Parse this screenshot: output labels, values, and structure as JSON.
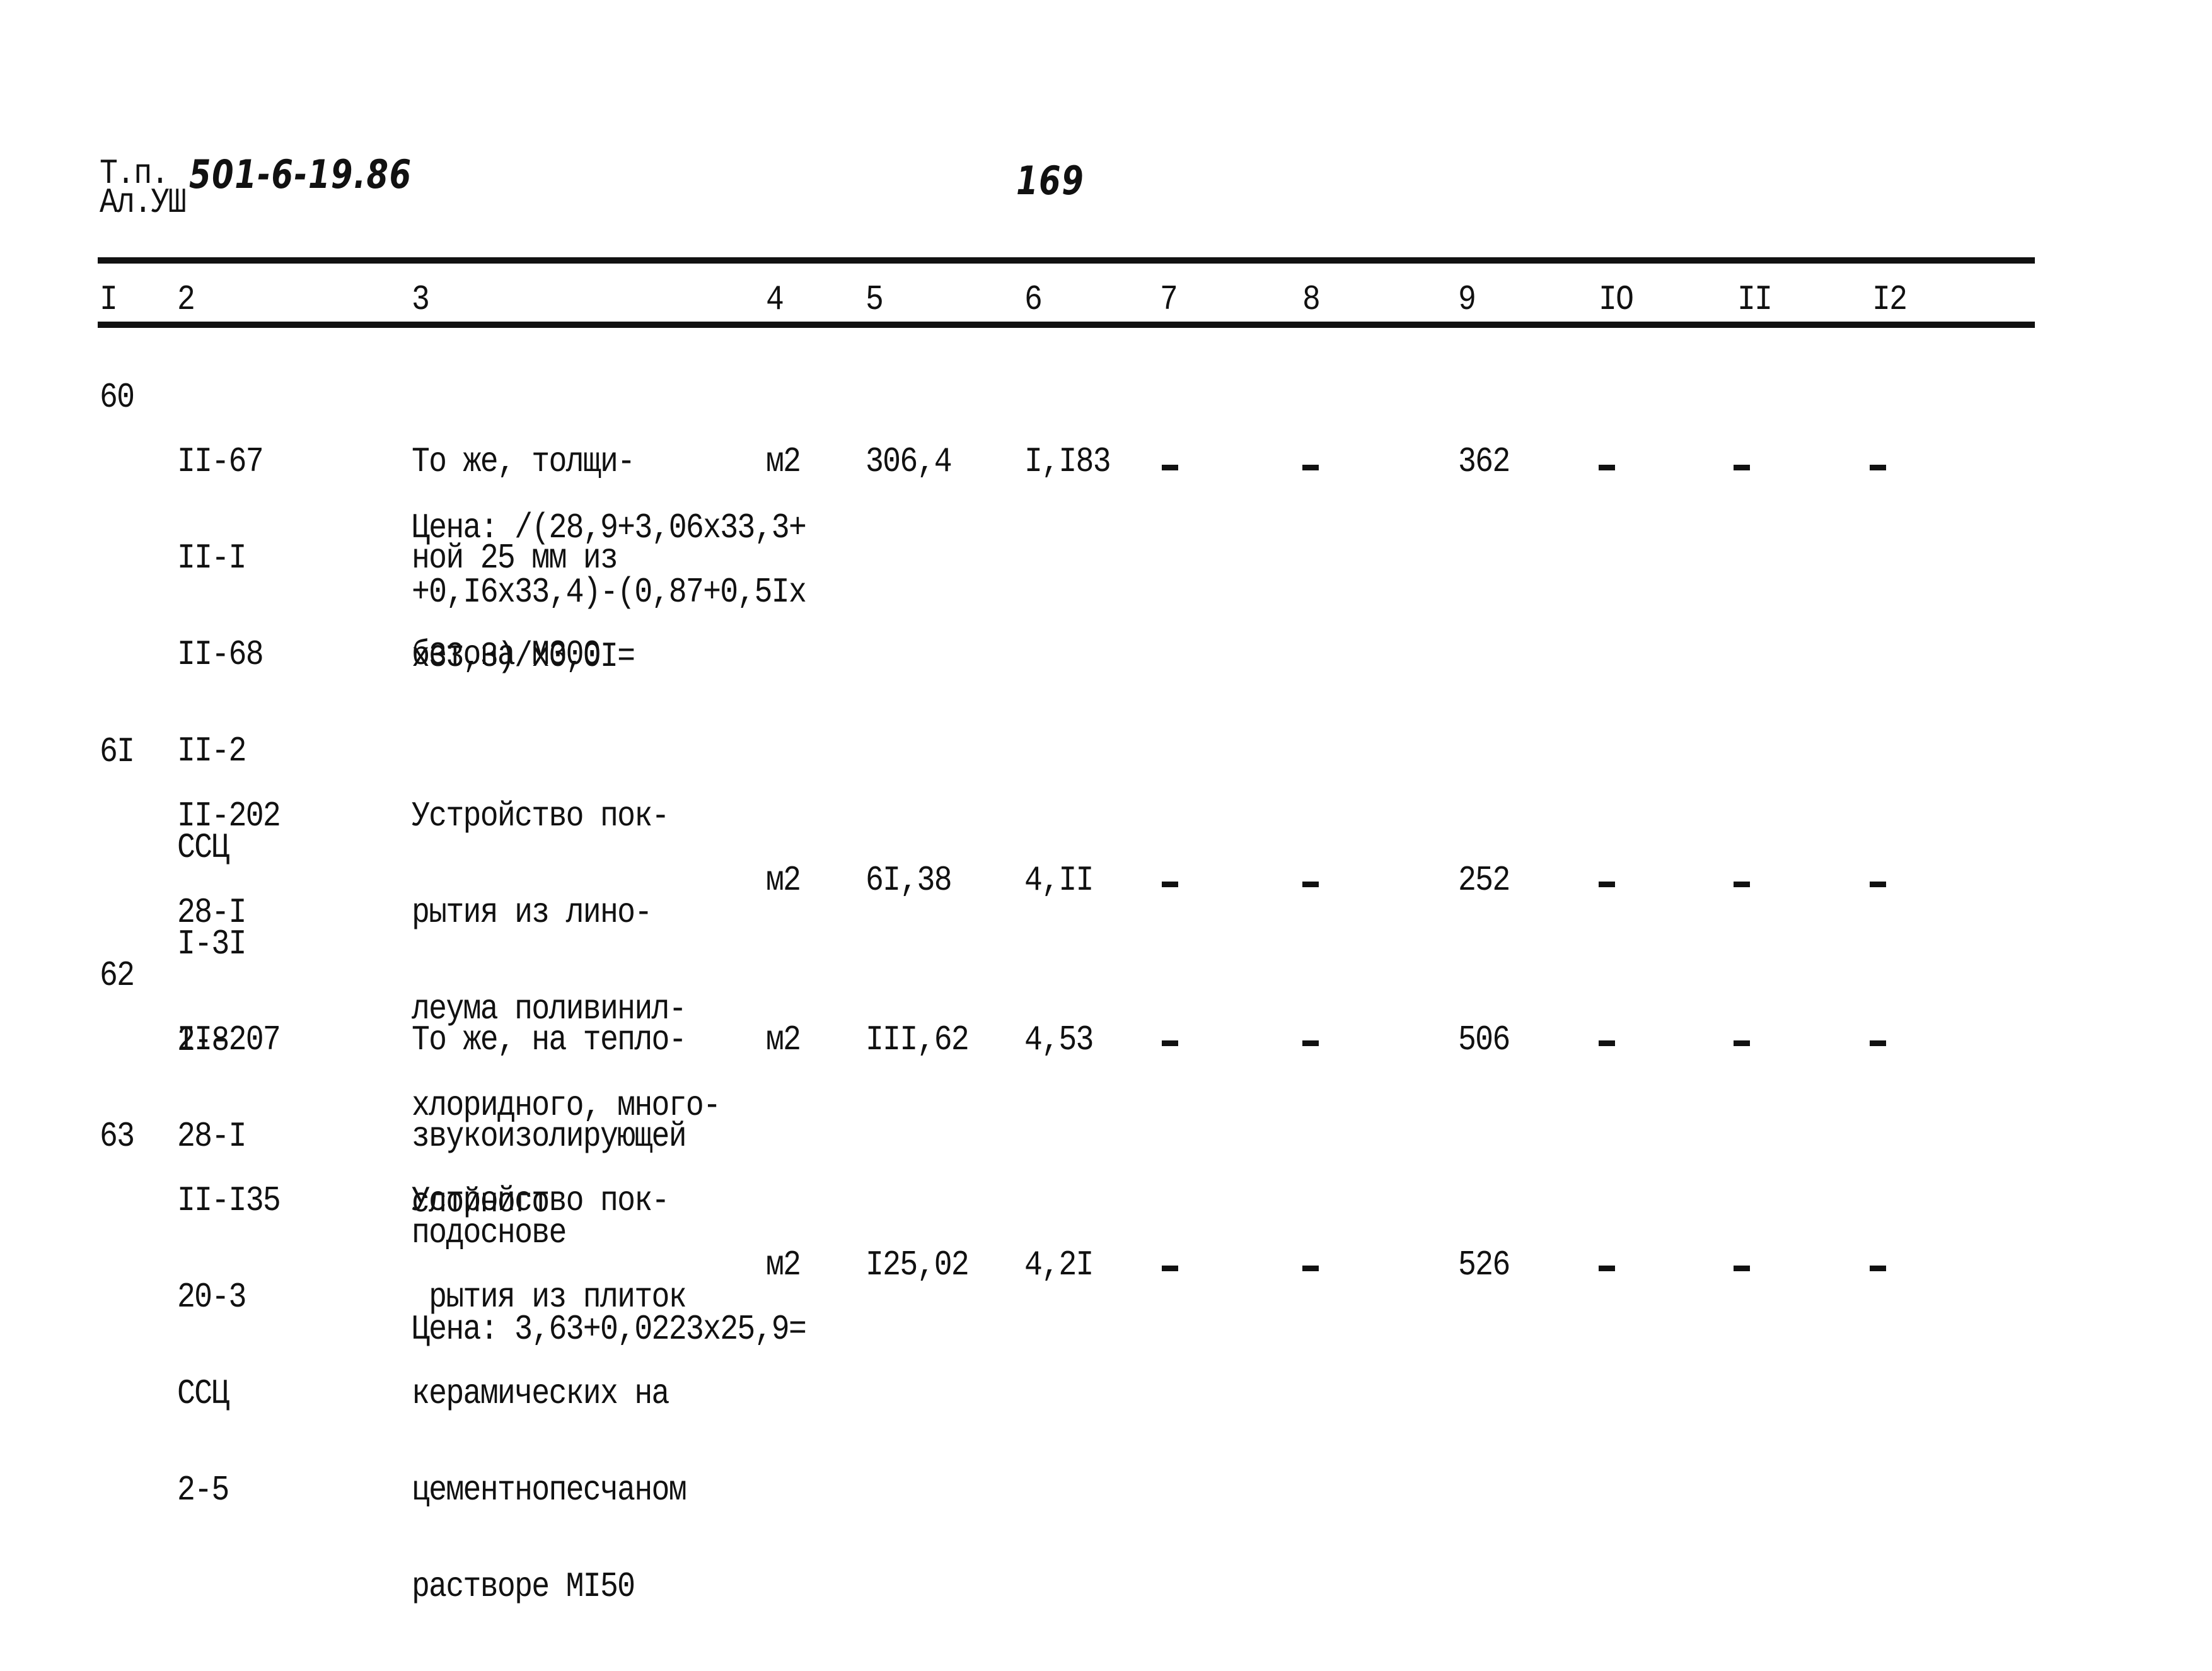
{
  "header": {
    "doc_prefix": "Т.п.",
    "doc_number": "501-6-19.86",
    "album": "Ал.УШ",
    "page_number": "169"
  },
  "columns": [
    "I",
    "2",
    "3",
    "4",
    "5",
    "6",
    "7",
    "8",
    "9",
    "IO",
    "II",
    "I2"
  ],
  "rows": [
    {
      "num": "60",
      "codes": [
        "II-67",
        "II-I",
        "II-68",
        "II-2",
        "ССЦ",
        "I-3I",
        "2-8"
      ],
      "description": [
        "То же, толщи-",
        "ной 25 мм из",
        "бетона М300"
      ],
      "unit": "м2",
      "qty": "306,4",
      "col6": "I,I83",
      "col7": "–",
      "col8": "–",
      "col9": "362",
      "col10": "–",
      "col11": "–",
      "col12": "–",
      "price_note": [
        "Цена: /(28,9+3,06х33,3+",
        "+0,I6х33,4)-(0,87+0,5Iх",
        "х33,3)/х0,0I="
      ]
    },
    {
      "num": "6I",
      "codes": [
        "II-202",
        "28-I"
      ],
      "description": [
        "Устройство пок-",
        "рытия из лино-",
        "леума поливинил-",
        "хлоридного, много-",
        "слойного"
      ],
      "unit": "м2",
      "qty": "6I,38",
      "col6": "4,II",
      "col7": "–",
      "col8": "–",
      "col9": "252",
      "col10": "–",
      "col11": "–",
      "col12": "–"
    },
    {
      "num": "62",
      "codes": [
        "II-207",
        "28-I"
      ],
      "description": [
        "То же, на тепло-",
        "звукоизолирующей",
        "подоснове"
      ],
      "unit": "м2",
      "qty": "III,62",
      "col6": "4,53",
      "col7": "–",
      "col8": "–",
      "col9": "506",
      "col10": "–",
      "col11": "–",
      "col12": "–"
    },
    {
      "num": "63",
      "codes": [
        "II-I35",
        "20-3",
        "ССЦ",
        "2-5"
      ],
      "description": [
        "Устройство пок-",
        " рытия из плиток",
        "керамических на",
        "цементнопесчаном",
        "растворе МI50"
      ],
      "unit": "м2",
      "qty": "I25,02",
      "col6": "4,2I",
      "col7": "–",
      "col8": "–",
      "col9": "526",
      "col10": "–",
      "col11": "–",
      "col12": "–",
      "price_note": [
        "Цена: 3,63+0,0223х25,9="
      ]
    }
  ]
}
